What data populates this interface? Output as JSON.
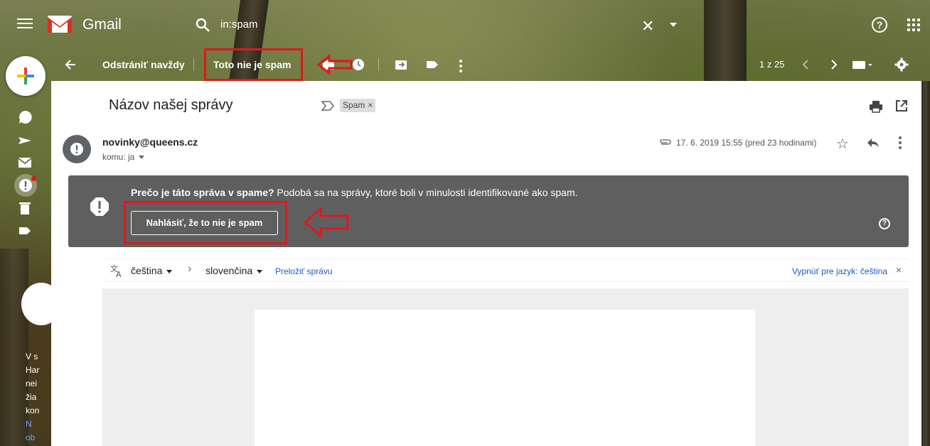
{
  "header": {
    "app_name": "Gmail",
    "search_query": "in:spam",
    "clear_symbol": "✕",
    "help_symbol": "?"
  },
  "toolbar": {
    "delete_forever": "Odstrániť navždy",
    "not_spam": "Toto nie je spam",
    "page_counter": "1 z 25"
  },
  "message": {
    "subject": "Názov našej správy",
    "label": "Spam",
    "label_remove": "×",
    "sender": "novinky@queens.cz",
    "recipient": "komu: ja",
    "date": "17. 6. 2019 15:55 (pred 23 hodinami)",
    "star": "☆"
  },
  "spam_warning": {
    "title": "Prečo je táto správa v spame?",
    "text": " Podobá sa na správy, ktoré boli v minulosti identifikované ako spam.",
    "report_button": "Nahlásiť, že to nie je spam",
    "help_symbol": "?"
  },
  "translation": {
    "source_lang": "čeština",
    "arrow": "›",
    "target_lang": "slovenčina",
    "translate_link": "Preložiť správu",
    "turn_off": "Vypnúť pre jazyk: čeština",
    "close": "×"
  },
  "sidebar_text": [
    "V s",
    "Han",
    "nei",
    "žia",
    "kon",
    "N",
    "ob"
  ],
  "colors": {
    "annotation_red": "#e0171c",
    "warning_bg": "#5f5f5f",
    "link_blue": "#1a5dbf"
  }
}
